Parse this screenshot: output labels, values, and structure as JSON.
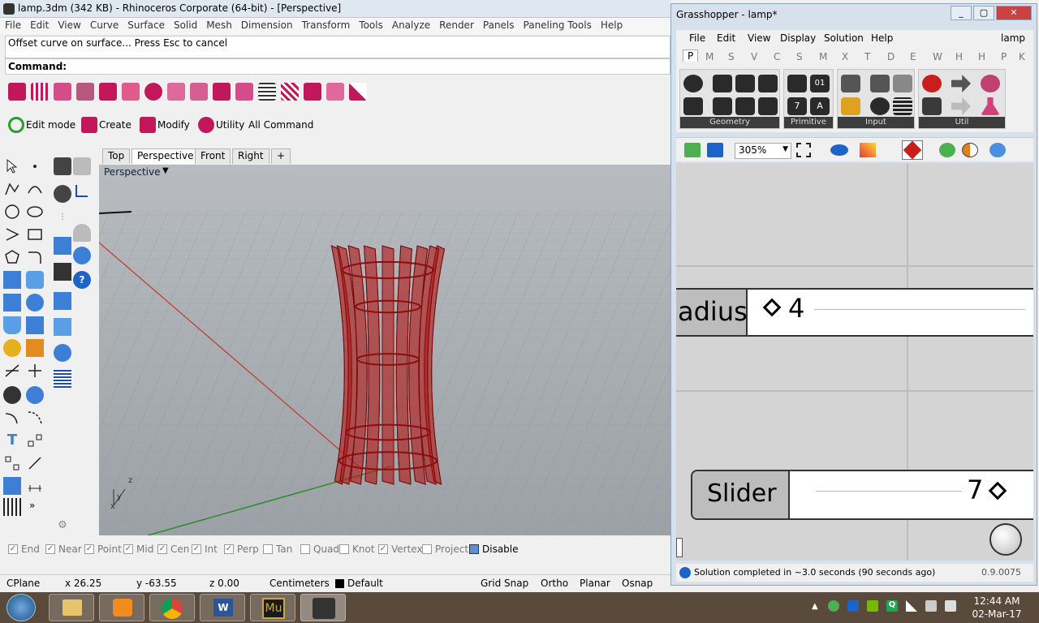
{
  "rhino": {
    "title": "lamp.3dm (342 KB) - Rhinoceros Corporate (64-bit) - [Perspective]",
    "menu": [
      "File",
      "Edit",
      "View",
      "Curve",
      "Surface",
      "Solid",
      "Mesh",
      "Dimension",
      "Transform",
      "Tools",
      "Analyze",
      "Render",
      "Panels",
      "Paneling Tools",
      "Help"
    ],
    "history": "Offset curve on surface... Press Esc to cancel",
    "command_label": "Command:",
    "toolbar2": [
      "Edit mode",
      "Create",
      "Modify",
      "Utility",
      "All Command"
    ],
    "view_tabs": [
      "Top",
      "Perspective",
      "Front",
      "Right",
      "+"
    ],
    "viewport_label": "Perspective",
    "osnaps": [
      {
        "label": "End",
        "checked": true
      },
      {
        "label": "Near",
        "checked": true
      },
      {
        "label": "Point",
        "checked": true
      },
      {
        "label": "Mid",
        "checked": true
      },
      {
        "label": "Cen",
        "checked": true
      },
      {
        "label": "Int",
        "checked": true
      },
      {
        "label": "Perp",
        "checked": true
      },
      {
        "label": "Tan",
        "checked": false
      },
      {
        "label": "Quad",
        "checked": false
      },
      {
        "label": "Knot",
        "checked": false
      },
      {
        "label": "Vertex",
        "checked": true
      },
      {
        "label": "Project",
        "checked": false
      },
      {
        "label": "Disable",
        "checked": false
      }
    ],
    "status": {
      "cplane": "CPlane",
      "x": "x 26.25",
      "y": "y -63.55",
      "z": "z 0.00",
      "units": "Centimeters",
      "layer": "Default",
      "grid_snap": "Grid Snap",
      "ortho": "Ortho",
      "planar": "Planar",
      "osnap": "Osnap"
    },
    "axes": {
      "x": "x",
      "y": "y",
      "z": "z"
    }
  },
  "grasshopper": {
    "title": "Grasshopper - lamp*",
    "menu": [
      "File",
      "Edit",
      "View",
      "Display",
      "Solution",
      "Help"
    ],
    "doc_name": "lamp",
    "tabs": [
      "P",
      "M",
      "S",
      "V",
      "C",
      "S",
      "M",
      "X",
      "T",
      "D",
      "E",
      "W",
      "H",
      "H",
      "P",
      "K"
    ],
    "groups": [
      "Geometry",
      "Primitive",
      "Input",
      "Util"
    ],
    "zoom": "305%",
    "radius_slider": {
      "label": "adius",
      "value": "4"
    },
    "slider": {
      "label": "Slider",
      "value": "7"
    },
    "status_msg": "Solution completed in ~3.0 seconds (90 seconds ago)",
    "version": "0.9.0075"
  },
  "taskbar": {
    "time": "12:44 AM",
    "date": "02-Mar-17"
  },
  "colors": {
    "lamp": "#b01818",
    "x_axis": "#c0392b",
    "y_axis": "#2e8b2e",
    "accent": "#c2185b"
  }
}
